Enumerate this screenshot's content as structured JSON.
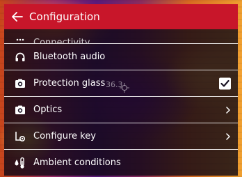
{
  "header": {
    "title": "Configuration",
    "back_icon": "arrow-left-icon",
    "background_color": "#c8162a"
  },
  "menu": {
    "items": [
      {
        "label": "Connectivity",
        "icon": "connectivity-icon",
        "partial": true
      },
      {
        "label": "Bluetooth audio",
        "icon": "headphones-icon"
      },
      {
        "label": "Protection glass",
        "icon": "camera-icon",
        "control": "checkbox",
        "checked": true
      },
      {
        "label": "Optics",
        "icon": "camera-icon",
        "control": "chevron"
      },
      {
        "label": "Configure key",
        "icon": "configure-key-icon",
        "control": "chevron"
      },
      {
        "label": "Ambient conditions",
        "icon": "thermometer-drop-icon"
      }
    ]
  },
  "overlay": {
    "temperature": "36.3"
  }
}
